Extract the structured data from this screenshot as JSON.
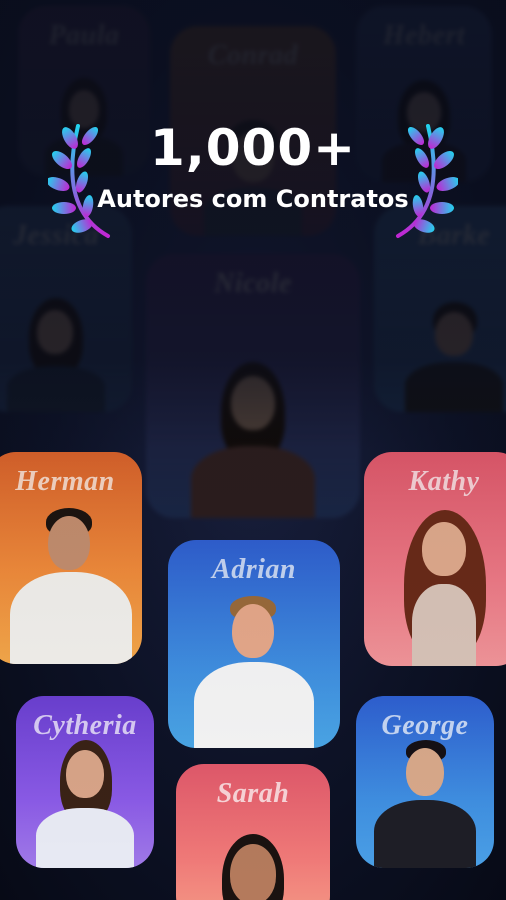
{
  "headline": {
    "count": "1,000+",
    "subtitle": "Autores com Contratos"
  },
  "colors": {
    "laurel_top": "#22d3ee",
    "laurel_bottom": "#c026d3",
    "background": "#0b0f1f"
  },
  "authors": {
    "top_left": "Paula",
    "top_center": "Conrad",
    "top_right": "Hebert",
    "mid_left": "Jessica",
    "mid_center": "Nicole",
    "mid_right": "Barke",
    "herman": "Herman",
    "kathy": "Kathy",
    "adrian": "Adrian",
    "cytheria": "Cytheria",
    "george": "George",
    "sarah": "Sarah"
  }
}
